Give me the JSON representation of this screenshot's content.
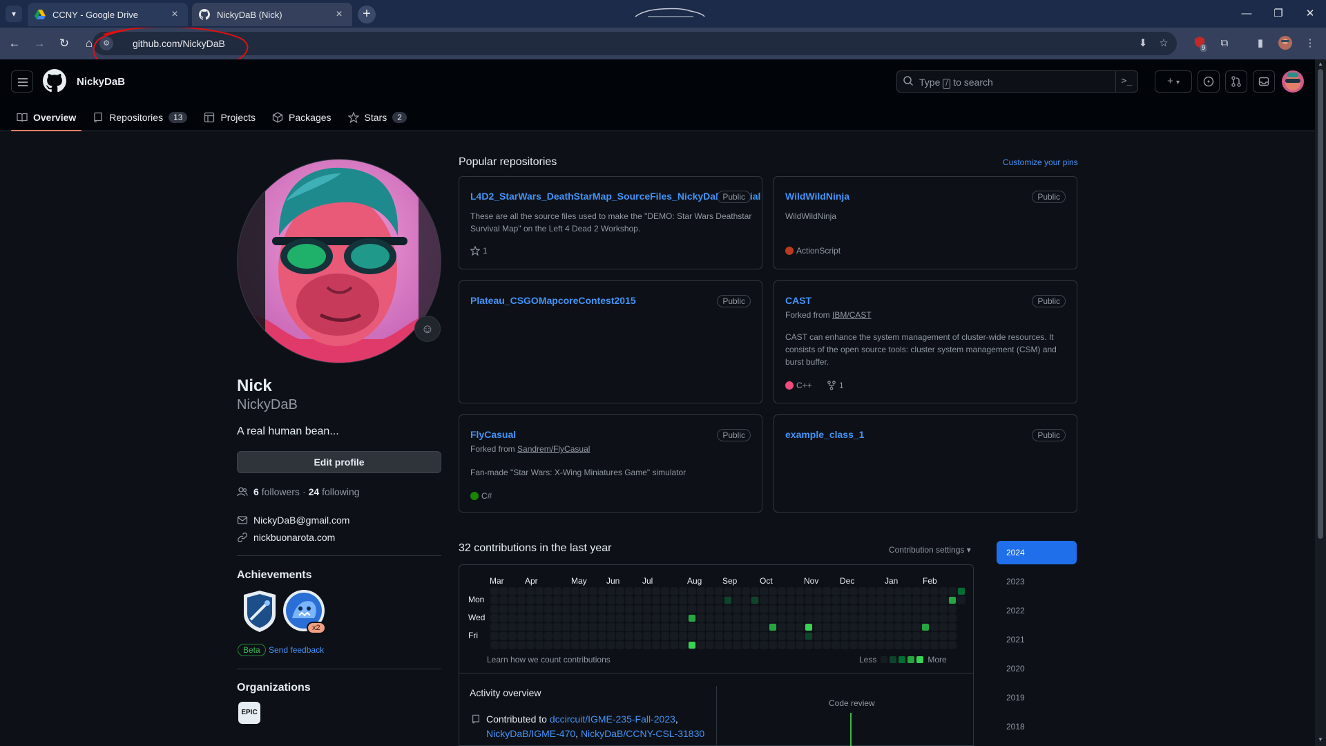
{
  "browser": {
    "tabs": [
      {
        "title": "CCNY - Google Drive",
        "active": false
      },
      {
        "title": "NickyDaB (Nick)",
        "active": true
      }
    ],
    "url": "github.com/NickyDaB",
    "extension_badge": "9"
  },
  "header": {
    "username": "NickyDaB",
    "search": {
      "prefix": "Type",
      "key": "/",
      "suffix": "to search"
    },
    "tabs": [
      {
        "label": "Overview",
        "icon": "book-icon",
        "count": "",
        "selected": true
      },
      {
        "label": "Repositories",
        "icon": "repo-icon",
        "count": "13",
        "selected": false
      },
      {
        "label": "Projects",
        "icon": "table-icon",
        "count": "",
        "selected": false
      },
      {
        "label": "Packages",
        "icon": "package-icon",
        "count": "",
        "selected": false
      },
      {
        "label": "Stars",
        "icon": "star-icon",
        "count": "2",
        "selected": false
      }
    ]
  },
  "profile": {
    "name": "Nick",
    "login": "NickyDaB",
    "bio": "A real human bean...",
    "edit_label": "Edit profile",
    "followers": "6",
    "followers_label": "followers",
    "separator": "·",
    "following": "24",
    "following_label": "following",
    "email": "NickyDaB@gmail.com",
    "website": "nickbuonarota.com",
    "achievements_title": "Achievements",
    "achievement_multiplier": "x2",
    "beta_label": "Beta",
    "feedback_label": "Send feedback",
    "orgs_title": "Organizations",
    "org_logo_text": "EPIC"
  },
  "repos": {
    "title": "Popular repositories",
    "customize_label": "Customize your pins",
    "public_label": "Public",
    "items": [
      {
        "name": "L4D2_StarWars_DeathStarMap_SourceFiles_NickyDaB_Official",
        "forked_prefix": "",
        "forked_from": "",
        "description": "These are all the source files used to make the \"DEMO: Star Wars Deathstar Survival Map\" on the Left 4 Dead 2 Workshop.",
        "language": "",
        "lang_color": "",
        "stars": "1",
        "forks": ""
      },
      {
        "name": "WildWildNinja",
        "forked_prefix": "",
        "forked_from": "",
        "description": "WildWildNinja",
        "language": "ActionScript",
        "lang_color": "#bb3a1d",
        "stars": "",
        "forks": ""
      },
      {
        "name": "Plateau_CSGOMapcoreContest2015",
        "forked_prefix": "",
        "forked_from": "",
        "description": "",
        "language": "",
        "lang_color": "",
        "stars": "",
        "forks": ""
      },
      {
        "name": "CAST",
        "forked_prefix": "Forked from",
        "forked_from": "IBM/CAST",
        "description": "CAST can enhance the system management of cluster-wide resources. It consists of the open source tools: cluster system management (CSM) and burst buffer.",
        "language": "C++",
        "lang_color": "#f34b7d",
        "stars": "",
        "forks": "1"
      },
      {
        "name": "FlyCasual",
        "forked_prefix": "Forked from",
        "forked_from": "Sandrem/FlyCasual",
        "description": "Fan-made \"Star Wars: X-Wing Miniatures Game\" simulator",
        "language": "C#",
        "lang_color": "#178600",
        "stars": "",
        "forks": ""
      },
      {
        "name": "example_class_1",
        "forked_prefix": "",
        "forked_from": "",
        "description": "",
        "language": "",
        "lang_color": "",
        "stars": "",
        "forks": ""
      }
    ]
  },
  "contributions": {
    "title": "32 contributions in the last year",
    "settings_label": "Contribution settings ▾",
    "months": [
      "Mar",
      "Apr",
      "May",
      "Jun",
      "Jul",
      "Aug",
      "Sep",
      "Oct",
      "Nov",
      "Dec",
      "Jan",
      "Feb"
    ],
    "days": [
      "Mon",
      "Wed",
      "Fri"
    ],
    "learn_label": "Learn how we count contributions",
    "less_label": "Less",
    "more_label": "More",
    "active_cells": [
      {
        "week": 22,
        "day": 3,
        "level": 3
      },
      {
        "week": 22,
        "day": 6,
        "level": 4
      },
      {
        "week": 26,
        "day": 1,
        "level": 1
      },
      {
        "week": 29,
        "day": 1,
        "level": 1
      },
      {
        "week": 31,
        "day": 4,
        "level": 3
      },
      {
        "week": 35,
        "day": 4,
        "level": 4
      },
      {
        "week": 35,
        "day": 5,
        "level": 1
      },
      {
        "week": 48,
        "day": 4,
        "level": 3
      },
      {
        "week": 51,
        "day": 1,
        "level": 3
      },
      {
        "week": 52,
        "day": 0,
        "level": 2
      }
    ]
  },
  "activity": {
    "title": "Activity overview",
    "contributed_prefix": "Contributed to",
    "repos": [
      "dccircuit/IGME-235-Fall-2023",
      "NickyDaB/IGME-470",
      "NickyDaB/CCNY-CSL-31830"
    ],
    "code_review_label": "Code review"
  },
  "years": [
    "2024",
    "2023",
    "2022",
    "2021",
    "2020",
    "2019",
    "2018"
  ],
  "colors": {
    "accent": "#4493f8",
    "selected_tab_underline": "#f78166",
    "year_selected": "#1f6feb",
    "contrib_levels": [
      "#161b22",
      "#0e4429",
      "#006d32",
      "#26a641",
      "#39d353"
    ]
  }
}
